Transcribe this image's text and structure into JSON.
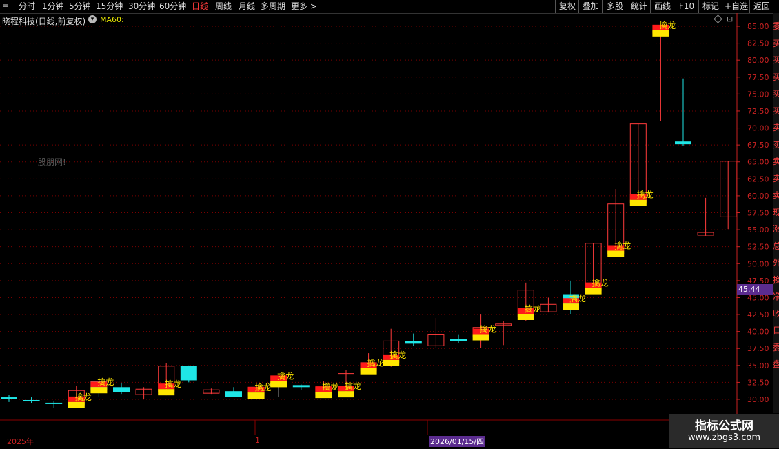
{
  "toolbar": {
    "left_items": [
      "分时",
      "1分钟",
      "5分钟",
      "15分钟",
      "30分钟",
      "60分钟",
      "日线",
      "周线",
      "月线",
      "多周期",
      "更多 >"
    ],
    "active": "日线",
    "right_items": [
      "复权",
      "叠加",
      "多股",
      "统计",
      "画线",
      "F10",
      "标记",
      "+自选",
      "返回"
    ]
  },
  "stock": {
    "title": "晓程科技(日线,前复权)",
    "ma_label": "MA60:"
  },
  "watermark": "股朋网!",
  "price_tag": "45.44",
  "dates": {
    "start": "2025年",
    "mid": "1",
    "cursor": "2026/01/15/四"
  },
  "brand": {
    "title": "指标公式网",
    "url": "www.zbgs3.com"
  },
  "side_text": [
    "委",
    "买",
    "买",
    "买",
    "买",
    "买",
    "卖",
    "卖",
    "卖",
    "卖",
    "卖",
    "现",
    "涨",
    "总",
    "外",
    "换",
    "净",
    "收",
    "日",
    "委",
    "盘"
  ],
  "colors": {
    "up": "#ff3b3b",
    "down": "#1fe6e6",
    "grid": "#7a0000",
    "label": "#ffe600"
  },
  "chart_data": {
    "type": "candlestick",
    "ylim": [
      28,
      86
    ],
    "y_ticks": [
      30.0,
      32.5,
      35.0,
      37.5,
      40.0,
      42.5,
      45.0,
      47.5,
      50.0,
      52.5,
      55.0,
      57.5,
      60.0,
      62.5,
      65.0,
      67.5,
      70.0,
      72.5,
      75.0,
      77.5,
      80.0,
      82.5,
      85.0
    ],
    "signal_text": "擒龙",
    "candles": [
      {
        "o": 30.2,
        "c": 30.3,
        "h": 30.7,
        "l": 29.6,
        "dir": "down",
        "signal": false
      },
      {
        "o": 29.9,
        "c": 29.7,
        "h": 30.3,
        "l": 29.4,
        "dir": "down",
        "signal": false
      },
      {
        "o": 29.5,
        "c": 29.4,
        "h": 29.7,
        "l": 28.7,
        "dir": "down",
        "signal": false
      },
      {
        "o": 29.2,
        "c": 31.3,
        "h": 32.0,
        "l": 28.9,
        "dir": "up",
        "signal": true
      },
      {
        "o": 32.7,
        "c": 31.4,
        "h": 32.7,
        "l": 30.3,
        "dir": "down",
        "signal": true
      },
      {
        "o": 31.8,
        "c": 31.1,
        "h": 32.4,
        "l": 30.8,
        "dir": "down",
        "signal": false
      },
      {
        "o": 30.7,
        "c": 31.5,
        "h": 31.8,
        "l": 30.1,
        "dir": "up",
        "signal": false
      },
      {
        "o": 31.1,
        "c": 34.9,
        "h": 35.3,
        "l": 30.6,
        "dir": "up",
        "signal": true
      },
      {
        "o": 34.9,
        "c": 32.8,
        "h": 35.0,
        "l": 32.5,
        "dir": "down",
        "signal": false
      },
      {
        "o": 30.9,
        "c": 31.4,
        "h": 31.6,
        "l": 30.8,
        "dir": "up",
        "signal": false
      },
      {
        "o": 31.2,
        "c": 30.4,
        "h": 31.8,
        "l": 30.3,
        "dir": "down",
        "signal": false
      },
      {
        "o": 30.6,
        "c": 31.8,
        "h": 32.0,
        "l": 30.3,
        "dir": "up",
        "signal": true
      },
      {
        "o": 32.3,
        "c": 32.3,
        "h": 32.8,
        "l": 30.4,
        "dir": "doji",
        "signal": true
      },
      {
        "o": 32.1,
        "c": 31.8,
        "h": 32.2,
        "l": 31.4,
        "dir": "down",
        "signal": false
      },
      {
        "o": 30.7,
        "c": 31.8,
        "h": 32.7,
        "l": 30.6,
        "dir": "up",
        "signal": true
      },
      {
        "o": 30.8,
        "c": 33.8,
        "h": 34.3,
        "l": 30.6,
        "dir": "up",
        "signal": true
      },
      {
        "o": 34.2,
        "c": 35.4,
        "h": 36.8,
        "l": 34.0,
        "dir": "up",
        "signal": true
      },
      {
        "o": 35.4,
        "c": 38.6,
        "h": 40.4,
        "l": 34.8,
        "dir": "up",
        "signal": true
      },
      {
        "o": 38.6,
        "c": 38.2,
        "h": 39.7,
        "l": 37.9,
        "dir": "down",
        "signal": false
      },
      {
        "o": 37.9,
        "c": 39.6,
        "h": 42.0,
        "l": 37.6,
        "dir": "up",
        "signal": false
      },
      {
        "o": 38.9,
        "c": 38.6,
        "h": 39.6,
        "l": 38.3,
        "dir": "down",
        "signal": false
      },
      {
        "o": 39.2,
        "c": 40.6,
        "h": 42.6,
        "l": 37.6,
        "dir": "up",
        "signal": true
      },
      {
        "o": 41.0,
        "c": 41.1,
        "h": 41.5,
        "l": 38.0,
        "dir": "up",
        "signal": false
      },
      {
        "o": 42.2,
        "c": 46.1,
        "h": 47.2,
        "l": 41.6,
        "dir": "up",
        "signal": true
      },
      {
        "o": 42.9,
        "c": 44.0,
        "h": 45.0,
        "l": 42.8,
        "dir": "up",
        "signal": false
      },
      {
        "o": 45.5,
        "c": 43.7,
        "h": 47.5,
        "l": 42.6,
        "dir": "down",
        "signal": true
      },
      {
        "o": 46.0,
        "c": 53.0,
        "h": 53.0,
        "l": 45.5,
        "dir": "up",
        "signal": true
      },
      {
        "o": 51.5,
        "c": 58.8,
        "h": 61.0,
        "l": 51.3,
        "dir": "up",
        "signal": true
      },
      {
        "o": 59.0,
        "c": 70.6,
        "h": 70.6,
        "l": 58.5,
        "dir": "up",
        "signal": true
      },
      {
        "o": 84.0,
        "c": 84.3,
        "h": 84.8,
        "l": 71.0,
        "dir": "up",
        "signal": true
      },
      {
        "o": 68.0,
        "c": 67.6,
        "h": 77.3,
        "l": 67.4,
        "dir": "down",
        "signal": false
      },
      {
        "o": 54.2,
        "c": 54.6,
        "h": 59.7,
        "l": 54.1,
        "dir": "up",
        "signal": false
      },
      {
        "o": 56.9,
        "c": 65.1,
        "h": 65.1,
        "l": 55.1,
        "dir": "up",
        "signal": false
      }
    ]
  }
}
